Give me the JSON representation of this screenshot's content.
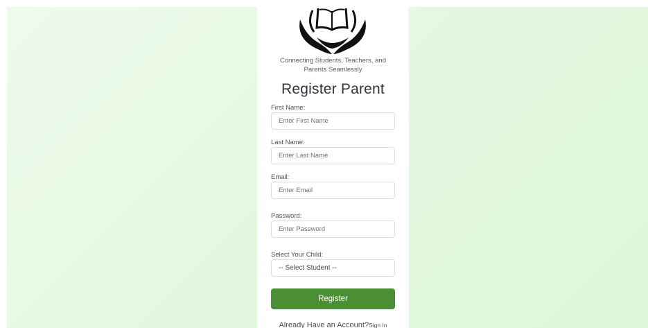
{
  "brand": {
    "logo_icon": "open-book-in-hands-icon",
    "tagline": "Connecting Students, Teachers, and Parents Seamlessly"
  },
  "form": {
    "title": "Register Parent",
    "first_name": {
      "label": "First Name:",
      "placeholder": "Enter First Name",
      "value": ""
    },
    "last_name": {
      "label": "Last Name:",
      "placeholder": "Enter Last Name",
      "value": ""
    },
    "email": {
      "label": "Email:",
      "placeholder": "Enter Email",
      "value": ""
    },
    "password": {
      "label": "Password:",
      "placeholder": "Enter Password",
      "value": ""
    },
    "child": {
      "label": "Select Your Child:",
      "selected": "-- Select Student --"
    },
    "submit_label": "Register"
  },
  "footer": {
    "text": "Already Have an Account?",
    "link_label": "Sign In"
  },
  "colors": {
    "primary_button": "#4a8f33",
    "background": "#e3f8df",
    "card": "#ffffff"
  }
}
